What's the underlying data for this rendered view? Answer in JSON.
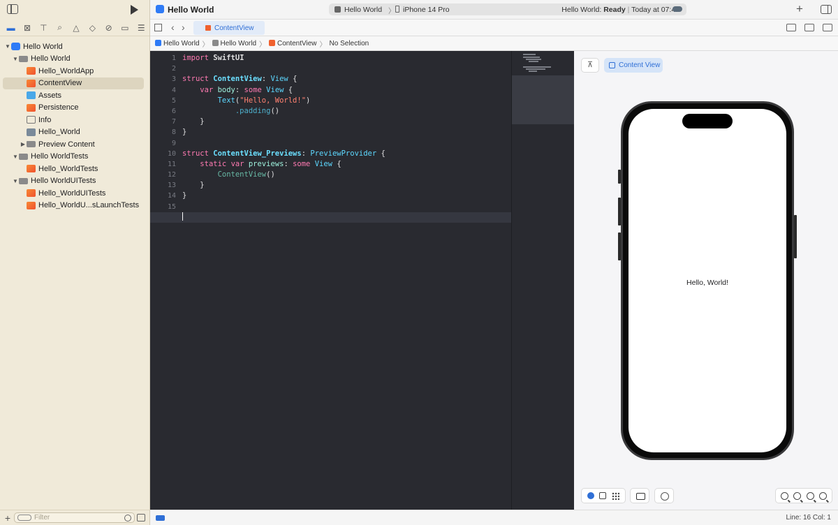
{
  "app": {
    "title": "Hello World"
  },
  "toolbar": {
    "scheme_target": "Hello World",
    "scheme_device": "iPhone 14 Pro",
    "status_prefix": "Hello World:",
    "status_state": "Ready",
    "status_time": "Today at 07:49"
  },
  "navigator": {
    "filter_placeholder": "Filter",
    "items": [
      {
        "label": "Hello World",
        "icon": "project-icon"
      },
      {
        "label": "Hello World",
        "icon": "folder-icon"
      },
      {
        "label": "Hello_WorldApp",
        "icon": "swift-file-icon"
      },
      {
        "label": "ContentView",
        "icon": "swift-file-icon"
      },
      {
        "label": "Assets",
        "icon": "asset-catalog-icon"
      },
      {
        "label": "Persistence",
        "icon": "swift-file-icon"
      },
      {
        "label": "Info",
        "icon": "plist-icon"
      },
      {
        "label": "Hello_World",
        "icon": "entitlements-icon"
      },
      {
        "label": "Preview Content",
        "icon": "folder-icon"
      },
      {
        "label": "Hello WorldTests",
        "icon": "folder-icon"
      },
      {
        "label": "Hello_WorldTests",
        "icon": "swift-file-icon"
      },
      {
        "label": "Hello WorldUITests",
        "icon": "folder-icon"
      },
      {
        "label": "Hello_WorldUITests",
        "icon": "swift-file-icon"
      },
      {
        "label": "Hello_WorldU...sLaunchTests",
        "icon": "swift-file-icon"
      }
    ]
  },
  "tabs": {
    "active": "ContentView"
  },
  "jumpbar": {
    "project": "Hello World",
    "group": "Hello World",
    "file": "ContentView",
    "selection": "No Selection"
  },
  "editor": {
    "line_numbers": [
      "1",
      "2",
      "3",
      "4",
      "5",
      "6",
      "7",
      "8",
      "9",
      "10",
      "11",
      "12",
      "13",
      "14",
      "15",
      "16"
    ],
    "current_line": "16",
    "code": {
      "import_kw": "import",
      "import_mod": "SwiftUI",
      "struct_kw": "struct",
      "content_view": "ContentView",
      "view_type": "View",
      "var_kw": "var",
      "body": "body",
      "some_kw": "some",
      "text_fn": "Text",
      "hello_str": "\"Hello, World!\"",
      "padding": ".padding",
      "previews_struct": "ContentView_Previews",
      "preview_provider": "PreviewProvider",
      "static_kw": "static",
      "previews": "previews"
    }
  },
  "canvas": {
    "chip_label": "Content View",
    "preview_text": "Hello, World!"
  },
  "statusbar": {
    "position": "Line: 16  Col: 1"
  },
  "colors": {
    "accent": "#2f6fd6",
    "editor_bg": "#292a30",
    "sidebar_bg": "#f0ead9"
  }
}
